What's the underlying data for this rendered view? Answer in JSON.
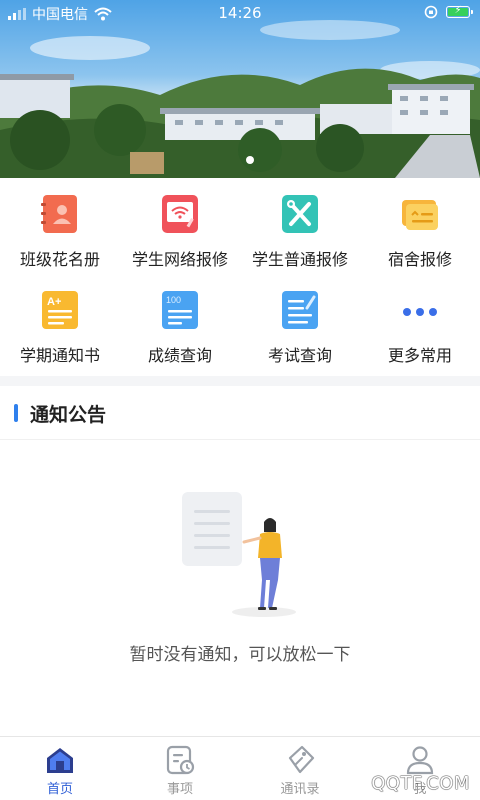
{
  "status_bar": {
    "carrier": "中国电信",
    "time": "14:26"
  },
  "grid": {
    "items": [
      {
        "label": "班级花名册",
        "icon": "class-roster-icon",
        "color": "#f26b4f"
      },
      {
        "label": "学生网络报修",
        "icon": "network-repair-icon",
        "color": "#f0525a"
      },
      {
        "label": "学生普通报修",
        "icon": "tools-repair-icon",
        "color": "#33c3b6"
      },
      {
        "label": "宿舍报修",
        "icon": "dorm-repair-icon",
        "color": "#f7b53b"
      },
      {
        "label": "学期通知书",
        "icon": "report-card-icon",
        "color": "#f9b930"
      },
      {
        "label": "成绩查询",
        "icon": "grade-query-icon",
        "color": "#4aa3f2"
      },
      {
        "label": "考试查询",
        "icon": "exam-query-icon",
        "color": "#4aa3f2"
      },
      {
        "label": "更多常用",
        "icon": "more-icon",
        "color": "#3a6ee8"
      }
    ]
  },
  "notice": {
    "title": "通知公告",
    "empty_message": "暂时没有通知，可以放松一下"
  },
  "tabbar": {
    "tabs": [
      {
        "label": "首页",
        "icon": "home-icon",
        "active": true
      },
      {
        "label": "事项",
        "icon": "tasks-icon",
        "active": false
      },
      {
        "label": "通讯录",
        "icon": "contacts-icon",
        "active": false
      },
      {
        "label": "我",
        "icon": "profile-icon",
        "active": false
      }
    ]
  },
  "watermark": "QQTF.COM",
  "colors": {
    "accent": "#2f5fd6",
    "notice_bar": "#2f80ed",
    "battery": "#37d05c"
  }
}
